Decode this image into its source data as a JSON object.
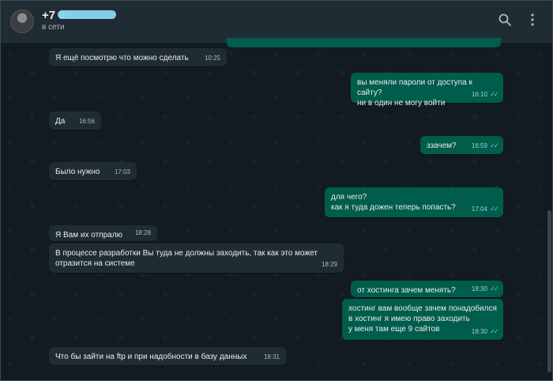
{
  "contact": {
    "name_prefix": "+7 9",
    "status": "в сети"
  },
  "messages": [
    {
      "dir": "in",
      "text": "Я ещё посмотрю что можно сделать",
      "time": "10:25"
    },
    {
      "dir": "out",
      "text": "вы меняли пароли от доступа к сайту?\nни в один не могу войти",
      "time": "16:10",
      "read": true
    },
    {
      "dir": "in",
      "text": "Да",
      "time": "16:56"
    },
    {
      "dir": "out",
      "text": "ззачем?",
      "time": "16:59",
      "read": true
    },
    {
      "dir": "in",
      "text": "Было нужно",
      "time": "17:03"
    },
    {
      "dir": "out",
      "text": "для чего?\nкак я туда дожен теперь попасть?",
      "time": "17:04",
      "read": true
    },
    {
      "dir": "in",
      "text": "Я Вам их отпралю",
      "time": "18:28"
    },
    {
      "dir": "in",
      "text": "В процессе разработки Вы туда не должны заходить, так как это может\nотразится на системе",
      "time": "18:29"
    },
    {
      "dir": "out",
      "text": "от хостинга зачем менять?",
      "time": "18:30",
      "read": true
    },
    {
      "dir": "out",
      "text": "хостинг вам вообще зачем понадобился\nв хостинг я имею право заходить\nу меня там еще 9 сайтов",
      "time": "18:30",
      "read": true
    },
    {
      "dir": "in",
      "text": "Что бы зайти на ftp и при надобности в базу данных",
      "time": "18:31"
    }
  ],
  "icons": {
    "search": "search-icon",
    "menu": "more-vertical-icon"
  }
}
